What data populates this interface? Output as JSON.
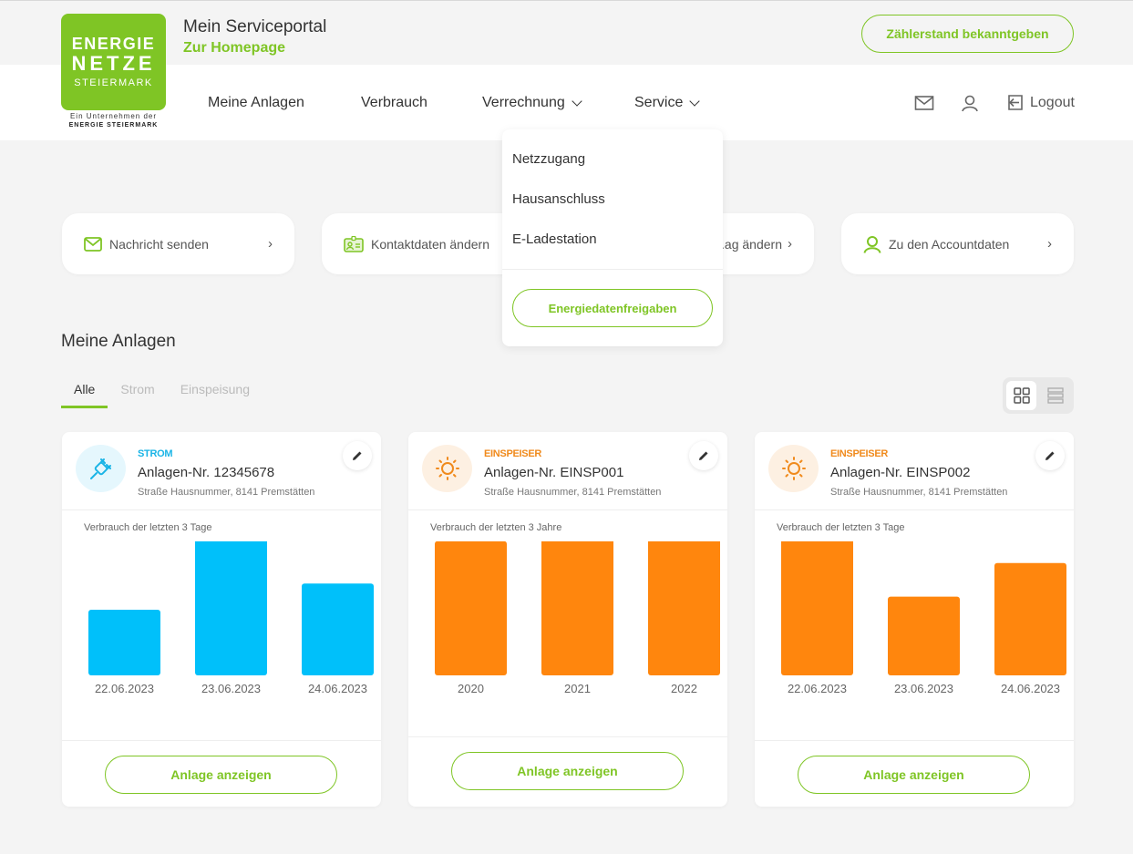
{
  "header": {
    "logo": {
      "line1": "ENERGIE",
      "line2": "NETZE",
      "line3": "STEIERMARK",
      "sub1": "Ein Unternehmen der",
      "sub2": "ENERGIE STEIERMARK"
    },
    "portal_title": "Mein Serviceportal",
    "homepage_link": "Zur Homepage",
    "meter_button": "Zählerstand bekanntgeben"
  },
  "nav": {
    "items": [
      {
        "label": "Meine Anlagen",
        "icon": null
      },
      {
        "label": "Verbrauch",
        "icon": null
      },
      {
        "label": "Verrechnung",
        "icon": "chevron-down-icon"
      },
      {
        "label": "Service",
        "icon": "chevron-down-icon"
      }
    ],
    "mail_icon": "mail-icon",
    "user_icon": "user-icon",
    "logout_label": "Logout"
  },
  "service_dropdown": {
    "items": [
      "Netzzugang",
      "Hausanschluss",
      "E-Ladestation"
    ],
    "button": "Energiedatenfreigaben"
  },
  "quick_links": [
    {
      "label": "Nachricht senden",
      "icon": "mail-icon"
    },
    {
      "label": "Kontaktdaten ändern",
      "icon": "contact-card-icon"
    },
    {
      "label": "...ag ändern",
      "icon": null
    },
    {
      "label": "Zu den Accountdaten",
      "icon": "user-icon"
    }
  ],
  "section": {
    "title": "Meine Anlagen",
    "tabs": [
      {
        "label": "Alle",
        "active": true
      },
      {
        "label": "Strom",
        "active": false
      },
      {
        "label": "Einspeisung",
        "active": false
      }
    ],
    "view": "grid"
  },
  "colors": {
    "brand_green": "#7fc525",
    "strom_blue": "#00c0fa",
    "einspeiser_orange": "#ff860d"
  },
  "cards": [
    {
      "type": "STROM",
      "type_color": "#1ab4e6",
      "anlage_nr": "Anlagen-Nr. 12345678",
      "address": "Straße Hausnummer, 8141 Premstätten",
      "chart_subtitle": "Verbrauch der letzten 3 Tage",
      "button": "Anlage anzeigen"
    },
    {
      "type": "EINSPEISER",
      "type_color": "#f08a1c",
      "anlage_nr": "Anlagen-Nr. EINSP001",
      "address": "Straße Hausnummer, 8141 Premstätten",
      "chart_subtitle": "Verbrauch der letzten 3 Jahre",
      "button": "Anlage anzeigen"
    },
    {
      "type": "EINSPEISER",
      "type_color": "#f08a1c",
      "anlage_nr": "Anlagen-Nr. EINSP002",
      "address": "Straße Hausnummer, 8141 Premstätten",
      "chart_subtitle": "Verbrauch der letzten 3 Tage",
      "button": "Anlage anzeigen"
    }
  ],
  "chart_data": [
    {
      "type": "bar",
      "title": "Verbrauch der letzten 3 Tage",
      "categories": [
        "22.06.2023",
        "23.06.2023",
        "24.06.2023"
      ],
      "values": [
        45,
        100,
        63
      ],
      "color": "#00c0fa",
      "ylim": [
        0,
        100
      ],
      "grid": false
    },
    {
      "type": "bar",
      "title": "Verbrauch der letzten 3 Jahre",
      "categories": [
        "2020",
        "2021",
        "2022"
      ],
      "values": [
        92,
        95,
        100
      ],
      "color": "#ff860d",
      "ylim": [
        0,
        100
      ],
      "grid": false
    },
    {
      "type": "bar",
      "title": "Verbrauch der letzten 3 Tage",
      "categories": [
        "22.06.2023",
        "23.06.2023",
        "24.06.2023"
      ],
      "values": [
        100,
        54,
        77
      ],
      "color": "#ff860d",
      "ylim": [
        0,
        100
      ],
      "grid": false
    }
  ]
}
